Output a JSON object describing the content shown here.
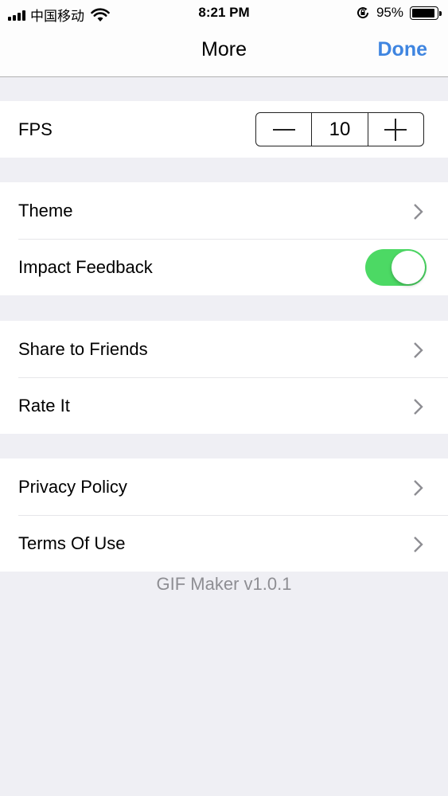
{
  "status_bar": {
    "carrier": "中国移动",
    "time": "8:21 PM",
    "battery_percent": "95%",
    "battery_level": 0.95,
    "icons": [
      "signal-icon",
      "wifi-icon",
      "rotation-lock-icon",
      "battery-icon"
    ]
  },
  "nav": {
    "title": "More",
    "done_label": "Done",
    "accent_color": "#3f85e0"
  },
  "fps": {
    "label": "FPS",
    "value": "10",
    "minus_symbol": "—",
    "plus_symbol": "+"
  },
  "settings": {
    "theme_label": "Theme",
    "impact_feedback_label": "Impact Feedback",
    "impact_feedback_on": true,
    "toggle_color": "#4cd964"
  },
  "share": {
    "share_label": "Share to Friends",
    "rate_label": "Rate It"
  },
  "legal": {
    "privacy_label": "Privacy Policy",
    "terms_label": "Terms Of Use"
  },
  "footer": {
    "version": "GIF Maker v1.0.1"
  }
}
